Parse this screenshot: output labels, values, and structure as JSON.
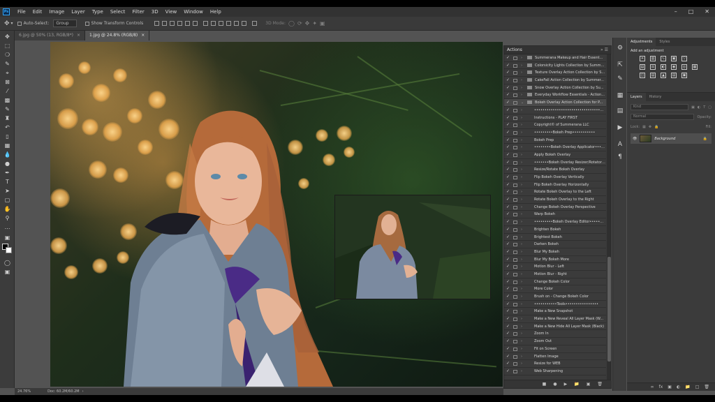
{
  "menubar": {
    "logo": "Ps",
    "items": [
      "File",
      "Edit",
      "Image",
      "Layer",
      "Type",
      "Select",
      "Filter",
      "3D",
      "View",
      "Window",
      "Help"
    ]
  },
  "options_bar": {
    "auto_select_label": "Auto-Select:",
    "auto_select_value": "Group",
    "transform_label": "Show Transform Controls",
    "mode_3d_label": "3D Mode:"
  },
  "doc_tabs": [
    {
      "label": "6.jpg @ 50% (13, RGB/8*)"
    },
    {
      "label": "1.jpg @ 24.8% (RGB/8)"
    }
  ],
  "status": {
    "zoom": "24.76%",
    "doc": "Doc: 60.2M/60.2M"
  },
  "actions_panel": {
    "title": "Actions",
    "rows": [
      {
        "label": "Summerana Makeup and Hair Essent...",
        "type": "set"
      },
      {
        "label": "Colorsicity Lights Collection by Summe...",
        "type": "set"
      },
      {
        "label": "Texture Overlay Action Collection by S...",
        "type": "set"
      },
      {
        "label": "CakeFall Action Collection by Summer...",
        "type": "set"
      },
      {
        "label": "Snow Overlay Action Collection by Su...",
        "type": "set"
      },
      {
        "label": "Everyday Workflow Essentials - Action...",
        "type": "set"
      },
      {
        "label": "Bokeh Overlay Action Collection for P...",
        "type": "set-open"
      },
      {
        "label": "••••••••••••••••••••••••••••••••••••",
        "type": "cmd"
      },
      {
        "label": "Instructions - PLAY FIRST",
        "type": "cmd"
      },
      {
        "label": "Copyright© of Summerana LLC",
        "type": "cmd"
      },
      {
        "label": "•••••••••Bokeh Prep•••••••••••",
        "type": "cmd"
      },
      {
        "label": "Bokeh Prep",
        "type": "cmd"
      },
      {
        "label": "••••••••Bokeh Overlay Applicator•••••••",
        "type": "cmd"
      },
      {
        "label": "Apply Bokeh Overlay",
        "type": "cmd"
      },
      {
        "label": "•••••••Bokeh Overlay Resizer/Rotator•••",
        "type": "cmd"
      },
      {
        "label": "Resize/Rotate Bokeh Overlay",
        "type": "cmd"
      },
      {
        "label": "Flip Bokeh Overlay Vertically",
        "type": "cmd"
      },
      {
        "label": "Flip Bokeh Overlay Horizontally",
        "type": "cmd"
      },
      {
        "label": "Rotate Bokeh Overlay to the Left",
        "type": "cmd"
      },
      {
        "label": "Rotate Bokeh Overlay to the Right",
        "type": "cmd"
      },
      {
        "label": "Change Bokeh Overlay Perspective",
        "type": "cmd"
      },
      {
        "label": "Warp Bokeh",
        "type": "cmd"
      },
      {
        "label": "•••••••••Bokeh Overlay Editor••••••••••",
        "type": "cmd"
      },
      {
        "label": "Brighten Bokeh",
        "type": "cmd"
      },
      {
        "label": "Brightest Bokeh",
        "type": "cmd"
      },
      {
        "label": "Darken Bokeh",
        "type": "cmd"
      },
      {
        "label": "Blur My Bokeh",
        "type": "cmd"
      },
      {
        "label": "Blur My Bokeh More",
        "type": "cmd"
      },
      {
        "label": "Motion Blur - Left",
        "type": "cmd"
      },
      {
        "label": "Motion Blur - Right",
        "type": "cmd"
      },
      {
        "label": "Change Bokeh Color",
        "type": "cmd"
      },
      {
        "label": "More Color",
        "type": "cmd"
      },
      {
        "label": "Brush on - Change Bokeh Color",
        "type": "cmd"
      },
      {
        "label": "•••••••••••Tools••••••••••••••••",
        "type": "cmd"
      },
      {
        "label": "Make a New Snapshot",
        "type": "cmd"
      },
      {
        "label": "Make a New Reveal All Layer Mask (W...",
        "type": "cmd"
      },
      {
        "label": "Make a New Hide All Layer Mask (Black)",
        "type": "cmd"
      },
      {
        "label": "Zoom In",
        "type": "cmd"
      },
      {
        "label": "Zoom Out",
        "type": "cmd"
      },
      {
        "label": "Fit on Screen",
        "type": "cmd"
      },
      {
        "label": "Flatten Image",
        "type": "cmd"
      },
      {
        "label": "Resize for WEB",
        "type": "cmd"
      },
      {
        "label": "Web Sharpening",
        "type": "cmd"
      }
    ]
  },
  "adjustments_panel": {
    "tabs": [
      "Adjustments",
      "Styles"
    ],
    "title": "Add an adjustment"
  },
  "layers_panel": {
    "tabs": [
      "Layers",
      "History"
    ],
    "kind_placeholder": "Kind",
    "blend_mode": "Normal",
    "opacity_label": "Opacity:",
    "fill_label": "Fill:",
    "lock_label": "Lock:",
    "layer_name": "Background"
  }
}
